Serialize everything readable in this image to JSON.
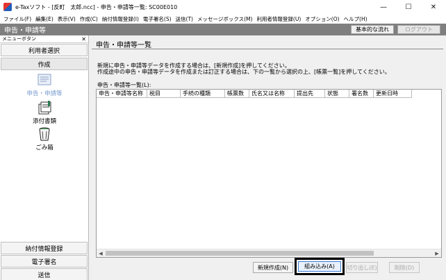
{
  "window": {
    "title": "e-Taxソフト - [反町　太郎.ncc] - 申告・申請等一覧: SC00E010",
    "controls": {
      "minimize": "—",
      "maximize": "☐",
      "close": "✕"
    }
  },
  "menubar": [
    "ファイル(F)",
    "編集(E)",
    "表示(V)",
    "作成(C)",
    "納付情報登録(I)",
    "電子署名(S)",
    "送信(T)",
    "メッセージボックス(M)",
    "利用者情報登録(U)",
    "オプション(O)",
    "ヘルプ(H)"
  ],
  "header": {
    "title": "申告・申請等",
    "basic_flow": "基本的な流れ",
    "logout": "ログアウト"
  },
  "sidebar": {
    "head_label": "メニューボタン",
    "close_glyph": "✕",
    "user_select": "利用者選択",
    "create": "作成",
    "tools": [
      {
        "label": "申告・申請等",
        "icon": "document-icon"
      },
      {
        "label": "添付書類",
        "icon": "attachment-icon"
      },
      {
        "label": "ごみ箱",
        "icon": "trash-icon"
      }
    ],
    "bottom": [
      "納付情報登録",
      "電子署名",
      "送信"
    ]
  },
  "main": {
    "title": "申告・申請等一覧",
    "desc1": "新規に申告・申請等データを作成する場合は、[新規作成]を押してください。",
    "desc2": "作成途中の申告・申請等データを作成または訂正する場合は、下の一覧から選択の上、[帳票一覧]を押してください。",
    "list_label": "申告・申請等一覧(L):",
    "columns": [
      "申告・申請等名称",
      "税目",
      "手続の種類",
      "帳票数",
      "氏名又は名称",
      "提出先",
      "状態",
      "署名数",
      "更新日時"
    ],
    "buttons": {
      "new": "新規作成(N)",
      "embed": "組み込み(A)",
      "cut": "切り出し(E)",
      "delete": "削除(D)"
    }
  },
  "colors": {
    "header_bg": "#7f7f7f",
    "main_bg": "#f0f0f0",
    "active_tool_label": "#7a9ccf",
    "highlight_frame": "#000000"
  }
}
